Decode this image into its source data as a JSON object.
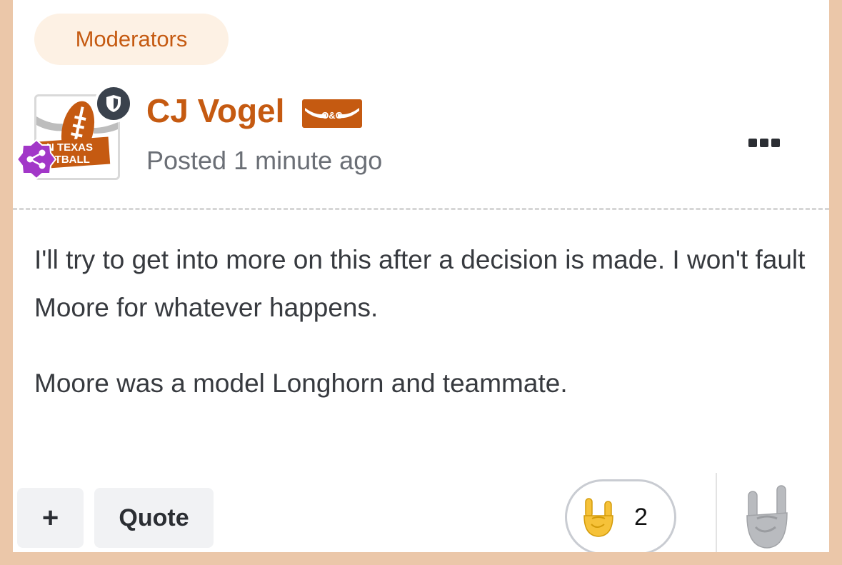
{
  "post": {
    "group_tag": "Moderators",
    "author": "CJ Vogel",
    "author_badge_text": "O&G",
    "posted_prefix": "Posted",
    "posted_time": "1 minute ago",
    "avatar_text": "ON TEXAS FOOTBALL",
    "avatar_text_line1": "N TEXAS",
    "avatar_text_line2": "OTBALL",
    "body": [
      "I'll try to get into more on this after a decision is made. I won't fault Moore for whatever happens.",
      "Moore was a model Longhorn and teammate."
    ]
  },
  "actions": {
    "plus_label": "+",
    "quote_label": "Quote",
    "reaction_count": "2"
  },
  "icons": {
    "more": "ellipsis-icon",
    "moderator": "shield-icon",
    "share": "share-icon",
    "reaction": "hook-em-hand-icon"
  },
  "colors": {
    "accent": "#c55a11",
    "page_border": "#ebc7a9",
    "tag_bg": "#fdf1e4",
    "share_badge": "#a237c8",
    "shield_badge": "#3a424d"
  }
}
